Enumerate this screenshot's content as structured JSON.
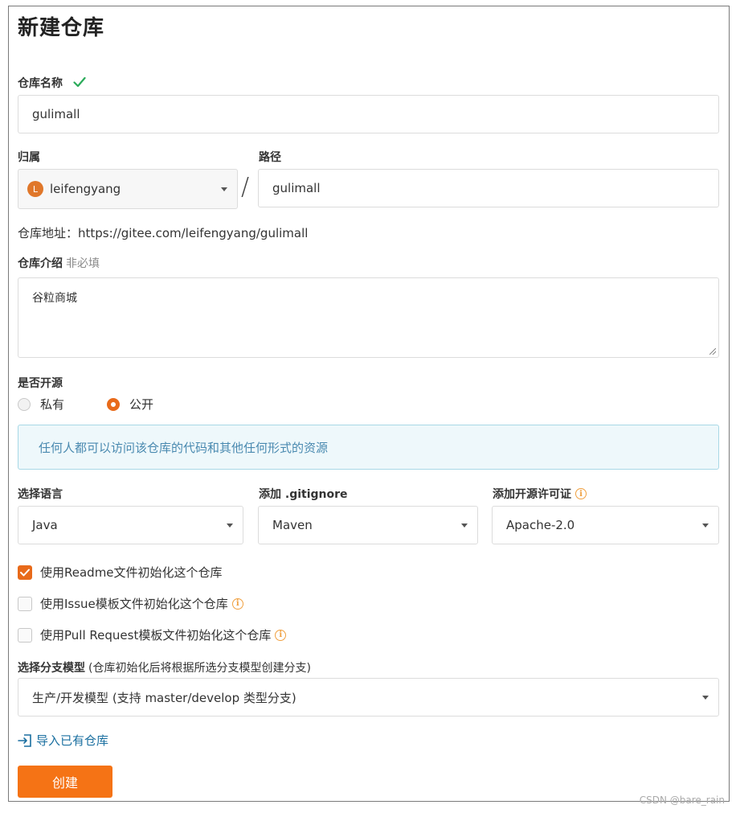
{
  "page_title": "新建仓库",
  "repo_name": {
    "label": "仓库名称",
    "value": "gulimall"
  },
  "owner": {
    "label": "归属",
    "value": "leifengyang",
    "avatar_letter": "L"
  },
  "path": {
    "label": "路径",
    "separator": "/",
    "value": "gulimall"
  },
  "repo_address": {
    "prefix": "仓库地址：",
    "url": "https://gitee.com/leifengyang/gulimall"
  },
  "intro": {
    "label": "仓库介绍",
    "optional": "非必填",
    "value": "谷粒商城"
  },
  "open_source": {
    "label": "是否开源",
    "options": [
      {
        "label": "私有",
        "selected": false
      },
      {
        "label": "公开",
        "selected": true
      }
    ],
    "notice": "任何人都可以访问该仓库的代码和其他任何形式的资源"
  },
  "language": {
    "label": "选择语言",
    "value": "Java"
  },
  "gitignore": {
    "label": "添加 .gitignore",
    "value": "Maven"
  },
  "license": {
    "label": "添加开源许可证",
    "value": "Apache-2.0"
  },
  "init_options": [
    {
      "label": "使用Readme文件初始化这个仓库",
      "checked": true
    },
    {
      "label": "使用Issue模板文件初始化这个仓库",
      "checked": false
    },
    {
      "label": "使用Pull Request模板文件初始化这个仓库",
      "checked": false
    }
  ],
  "branch_model": {
    "label": "选择分支模型",
    "hint": "(仓库初始化后将根据所选分支模型创建分支)",
    "value": "生产/开发模型 (支持 master/develop 类型分支)"
  },
  "import_link": "导入已有仓库",
  "create_button": "创建",
  "watermark": "CSDN @bare_rain",
  "colors": {
    "accent": "#f57315",
    "info_bg": "#eef8fb",
    "link": "#1a6fa0",
    "success": "#2bab5a"
  }
}
